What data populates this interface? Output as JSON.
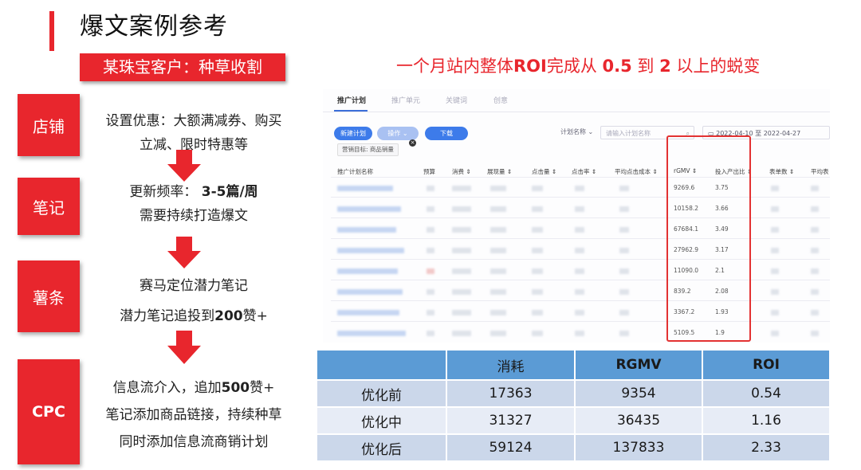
{
  "title": "爆文案例参考",
  "subtitle": "某珠宝客户：种草收割",
  "headline": {
    "part1": "一个月站内整体",
    "roi": "ROI",
    "part2": "完成从 ",
    "from": "0.5",
    "part3": " 到 ",
    "to": "2",
    "part4": " 以上的蜕变"
  },
  "steps": [
    {
      "label": "店铺",
      "lines": [
        {
          "text": "设置优惠：大额满减券、购买"
        },
        {
          "text": "立减、限时特惠等"
        }
      ]
    },
    {
      "label": "笔记",
      "lines": [
        {
          "text": "更新频率：",
          "bold": "3-5篇/周"
        },
        {
          "text": "需要持续打造爆文"
        }
      ]
    },
    {
      "label": "薯条",
      "lines": [
        {
          "text": "赛马定位潜力笔记"
        },
        {
          "text": "潜力笔记追投到",
          "bold": "200",
          "tail": "赞+"
        }
      ]
    },
    {
      "label": "CPC",
      "lines": [
        {
          "text": "信息流介入，追加",
          "bold": "500",
          "tail": "赞+"
        },
        {
          "text": "笔记添加商品链接，持续种草"
        },
        {
          "text": "同时添加信息流商销计划"
        }
      ]
    }
  ],
  "screenshot": {
    "tabs": [
      "推广计划",
      "推广单元",
      "关键词",
      "创意"
    ],
    "buttons": {
      "new_plan": "新建计划",
      "operate": "操作 ⌄",
      "download": "下载"
    },
    "plan_name_select": "计划名称 ⌄",
    "search_placeholder": "请输入计划名称",
    "date_range": {
      "start": "2022-04-10",
      "sep": "至",
      "end": "2022-04-27"
    },
    "goal_chip": "营销目标: 商品销量",
    "columns": [
      "推广计划名称",
      "预算",
      "消费 ⇕",
      "展现量 ⇕",
      "点击量 ⇕",
      "点击率 ⇕",
      "平均点击成本 ⇕",
      "rGMV ⇕",
      "投入产出比 ⇕",
      "表单数 ⇕",
      "平均表"
    ],
    "rows": [
      {
        "rgmv": "9269.6",
        "roi": "3.75"
      },
      {
        "rgmv": "10158.2",
        "roi": "3.66"
      },
      {
        "rgmv": "67684.1",
        "roi": "3.49"
      },
      {
        "rgmv": "27962.9",
        "roi": "3.17"
      },
      {
        "rgmv": "11090.0",
        "roi": "2.1"
      },
      {
        "rgmv": "839.2",
        "roi": "2.08"
      },
      {
        "rgmv": "3367.2",
        "roi": "1.93"
      },
      {
        "rgmv": "5109.5",
        "roi": "1.9"
      }
    ]
  },
  "comparison": {
    "headers": [
      "",
      "消耗",
      "RGMV",
      "ROI"
    ],
    "rows": [
      {
        "label": "优化前",
        "cost": "17363",
        "rgmv": "9354",
        "roi": "0.54"
      },
      {
        "label": "优化中",
        "cost": "31327",
        "rgmv": "36435",
        "roi": "1.16"
      },
      {
        "label": "优化后",
        "cost": "59124",
        "rgmv": "137833",
        "roi": "2.33"
      }
    ]
  },
  "colors": {
    "accent": "#e8262d",
    "table_header": "#5b9bd5",
    "highlight": "#e33232"
  }
}
